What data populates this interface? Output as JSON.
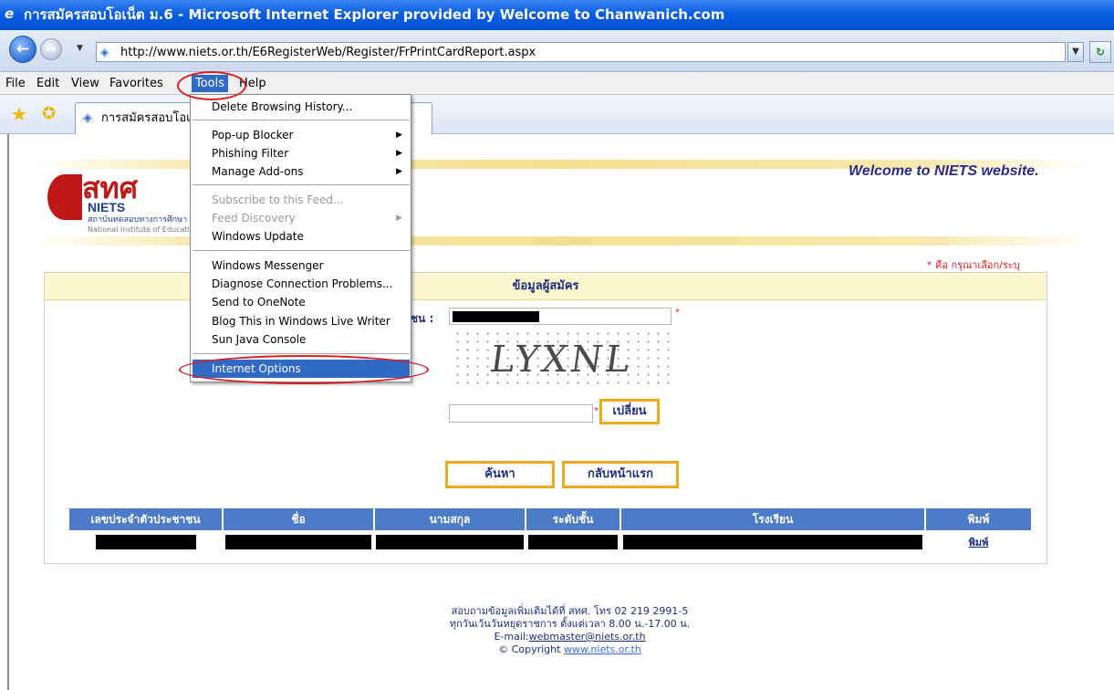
{
  "window": {
    "title": "การสมัครสอบโอเน็ต ม.6 - Microsoft Internet Explorer provided by Welcome to Chanwanich.com"
  },
  "address_bar": {
    "url": "http://www.niets.or.th/E6RegisterWeb/Register/FrPrintCardReport.aspx"
  },
  "menu": {
    "items": [
      "File",
      "Edit",
      "View",
      "Favorites",
      "Tools",
      "Help"
    ],
    "active": "Tools"
  },
  "tab": {
    "label": "การสมัครสอบโอเ"
  },
  "tools_menu": {
    "items": [
      {
        "label": "Delete Browsing History...",
        "enabled": true,
        "submenu": false
      },
      {
        "label": "Pop-up Blocker",
        "enabled": true,
        "submenu": true
      },
      {
        "label": "Phishing Filter",
        "enabled": true,
        "submenu": true
      },
      {
        "label": "Manage Add-ons",
        "enabled": true,
        "submenu": true
      },
      {
        "label": "Subscribe to this Feed...",
        "enabled": false,
        "submenu": false
      },
      {
        "label": "Feed Discovery",
        "enabled": false,
        "submenu": true
      },
      {
        "label": "Windows Update",
        "enabled": true,
        "submenu": false
      },
      {
        "label": "Windows Messenger",
        "enabled": true,
        "submenu": false
      },
      {
        "label": "Diagnose Connection Problems...",
        "enabled": true,
        "submenu": false
      },
      {
        "label": "Send to OneNote",
        "enabled": true,
        "submenu": false
      },
      {
        "label": "Blog This in Windows Live Writer",
        "enabled": true,
        "submenu": false
      },
      {
        "label": "Sun Java Console",
        "enabled": true,
        "submenu": false
      },
      {
        "label": "Internet Options",
        "enabled": true,
        "submenu": false,
        "selected": true
      }
    ]
  },
  "page": {
    "logo_thai": "สทศ",
    "logo_en": "NIETS",
    "logo_sub": "สถาบันทดสอบทางการศึกษา",
    "logo_sub2": "National Institute of Educational Testing Service",
    "welcome": "Welcome to NIETS website.",
    "required_note": "* คือ กรุณาเลือก/ระบุ",
    "panel_title": "ข้อมูลผู้สมัคร",
    "id_label": "ชน :",
    "captcha_text": "LYXNL",
    "change_button": "เปลี่ยน",
    "search_button": "ค้นหา",
    "home_button": "กลับหน้าแรก"
  },
  "results": {
    "columns": [
      "เลขประจำตัวประชาชน",
      "ชื่อ",
      "นามสกุล",
      "ระดับชั้น",
      "โรงเรียน",
      "พิมพ์"
    ],
    "print_link": "พิมพ์"
  },
  "footer": {
    "line1": "สอบถามข้อมูลเพิ่มเติมได้ที่ สทศ. โทร 02 219 2991-5",
    "line2": "ทุกวันเว้นวันหยุดราชการ ตั้งแต่เวลา 8.00 น.-17.00 น.",
    "email_label": "E-mail:",
    "email": "webmaster@niets.or.th",
    "copyright_label": "© Copyright",
    "copyright_link": "www.niets.or.th"
  }
}
